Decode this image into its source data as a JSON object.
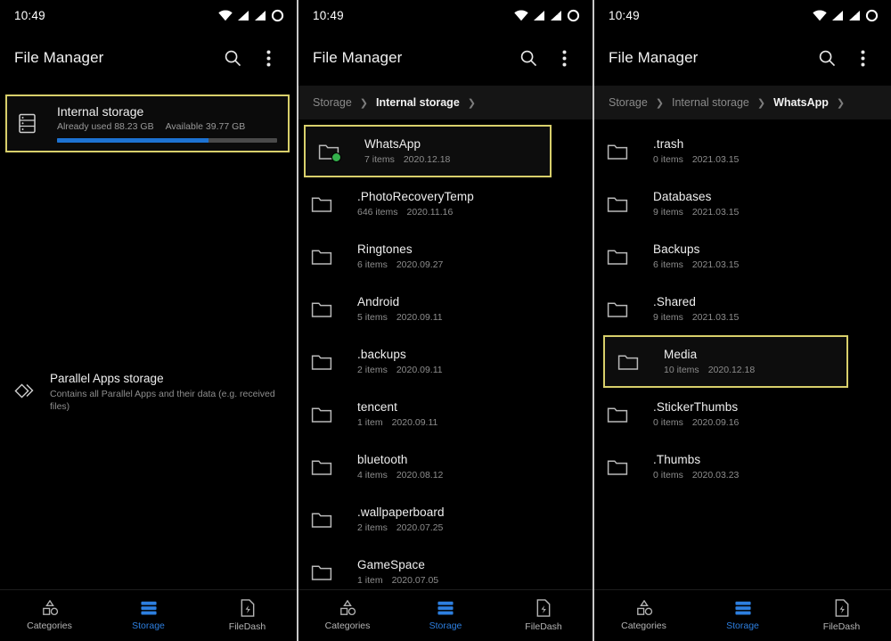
{
  "statusbar": {
    "time": "10:49",
    "icons": [
      "wifi-icon",
      "signal-bars-icon",
      "signal-no-sim-icon",
      "battery-circle-icon"
    ]
  },
  "appbar": {
    "title": "File Manager",
    "search_icon": "search-icon",
    "overflow_icon": "more-vertical-icon"
  },
  "bottom_nav": {
    "items": [
      {
        "label": "Categories",
        "icon": "shapes-icon",
        "active": false
      },
      {
        "label": "Storage",
        "icon": "storage-stack-icon",
        "active": true
      },
      {
        "label": "FileDash",
        "icon": "file-bolt-icon",
        "active": false
      }
    ],
    "active_color": "#2d7fe0"
  },
  "colors": {
    "background": "#000000",
    "highlight_border": "#d8cf6b",
    "accent_blue": "#1d72d2",
    "nav_active": "#2d7fe0",
    "badge_green": "#34b14c",
    "breadcrumb_bg": "#151515"
  },
  "panel1": {
    "storage_card": {
      "name": "Internal storage",
      "used_label": "Already used 88.23 GB",
      "available_label": "Available 39.77 GB",
      "used_percent": 69,
      "icon": "internal-storage-icon",
      "selected": true
    },
    "parallel_apps": {
      "title": "Parallel Apps storage",
      "description": "Contains all Parallel Apps and their data (e.g. received files)",
      "icon": "parallel-apps-icon"
    }
  },
  "panel2": {
    "breadcrumbs": [
      {
        "label": "Storage",
        "current": false
      },
      {
        "label": "Internal storage",
        "current": true
      }
    ],
    "files": [
      {
        "name": "WhatsApp",
        "items": "7 items",
        "date": "2020.12.18",
        "selected": true,
        "badge": true
      },
      {
        "name": ".PhotoRecoveryTemp",
        "items": "646 items",
        "date": "2020.11.16",
        "selected": false,
        "badge": false
      },
      {
        "name": "Ringtones",
        "items": "6 items",
        "date": "2020.09.27",
        "selected": false,
        "badge": false
      },
      {
        "name": "Android",
        "items": "5 items",
        "date": "2020.09.11",
        "selected": false,
        "badge": false
      },
      {
        "name": ".backups",
        "items": "2 items",
        "date": "2020.09.11",
        "selected": false,
        "badge": false
      },
      {
        "name": "tencent",
        "items": "1 item",
        "date": "2020.09.11",
        "selected": false,
        "badge": false
      },
      {
        "name": "bluetooth",
        "items": "4 items",
        "date": "2020.08.12",
        "selected": false,
        "badge": false
      },
      {
        "name": ".wallpaperboard",
        "items": "2 items",
        "date": "2020.07.25",
        "selected": false,
        "badge": false
      },
      {
        "name": "GameSpace",
        "items": "1 item",
        "date": "2020.07.05",
        "selected": false,
        "badge": false
      }
    ]
  },
  "panel3": {
    "breadcrumbs": [
      {
        "label": "Storage",
        "current": false
      },
      {
        "label": "Internal storage",
        "current": false
      },
      {
        "label": "WhatsApp",
        "current": true
      }
    ],
    "files": [
      {
        "name": ".trash",
        "items": "0 items",
        "date": "2021.03.15",
        "selected": false
      },
      {
        "name": "Databases",
        "items": "9 items",
        "date": "2021.03.15",
        "selected": false
      },
      {
        "name": "Backups",
        "items": "6 items",
        "date": "2021.03.15",
        "selected": false
      },
      {
        "name": ".Shared",
        "items": "9 items",
        "date": "2021.03.15",
        "selected": false
      },
      {
        "name": "Media",
        "items": "10 items",
        "date": "2020.12.18",
        "selected": true
      },
      {
        "name": ".StickerThumbs",
        "items": "0 items",
        "date": "2020.09.16",
        "selected": false
      },
      {
        "name": ".Thumbs",
        "items": "0 items",
        "date": "2020.03.23",
        "selected": false
      }
    ]
  }
}
